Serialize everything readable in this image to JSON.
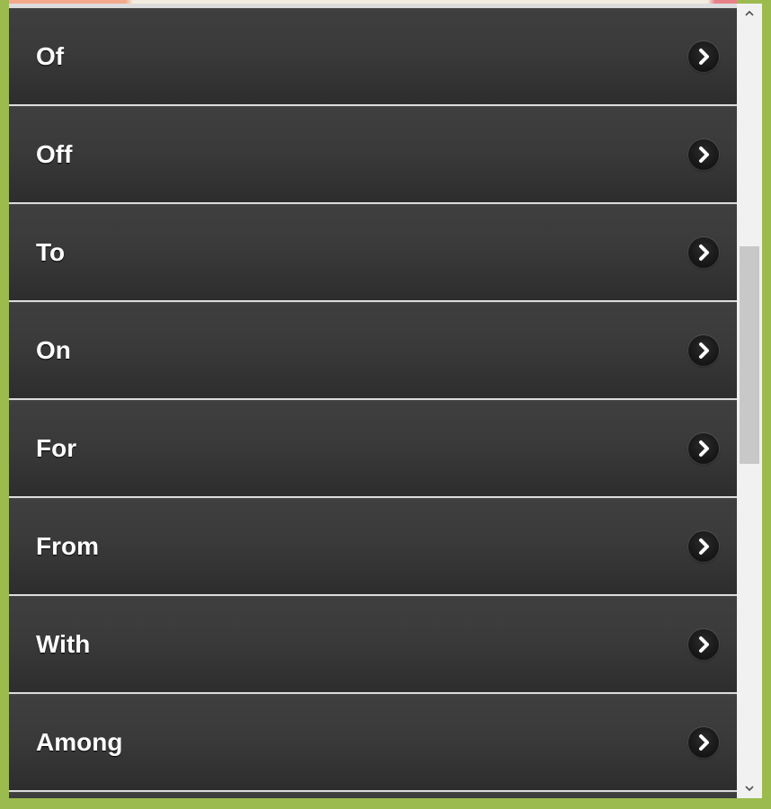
{
  "list": {
    "items": [
      {
        "label": "Of"
      },
      {
        "label": "Off"
      },
      {
        "label": "To"
      },
      {
        "label": "On"
      },
      {
        "label": "For"
      },
      {
        "label": "From"
      },
      {
        "label": "With"
      },
      {
        "label": "Among"
      }
    ]
  },
  "icons": {
    "item_arrow": "chevron-right-circle-icon",
    "scroll_up": "scroll-up-arrow-icon",
    "scroll_down": "scroll-down-arrow-icon"
  },
  "colors": {
    "frame": "#9bbb4f",
    "item_background": "#3a3a3a",
    "item_text": "#ffffff",
    "scroll_track": "#f1f1f1",
    "scroll_thumb": "#c8c8c8"
  }
}
